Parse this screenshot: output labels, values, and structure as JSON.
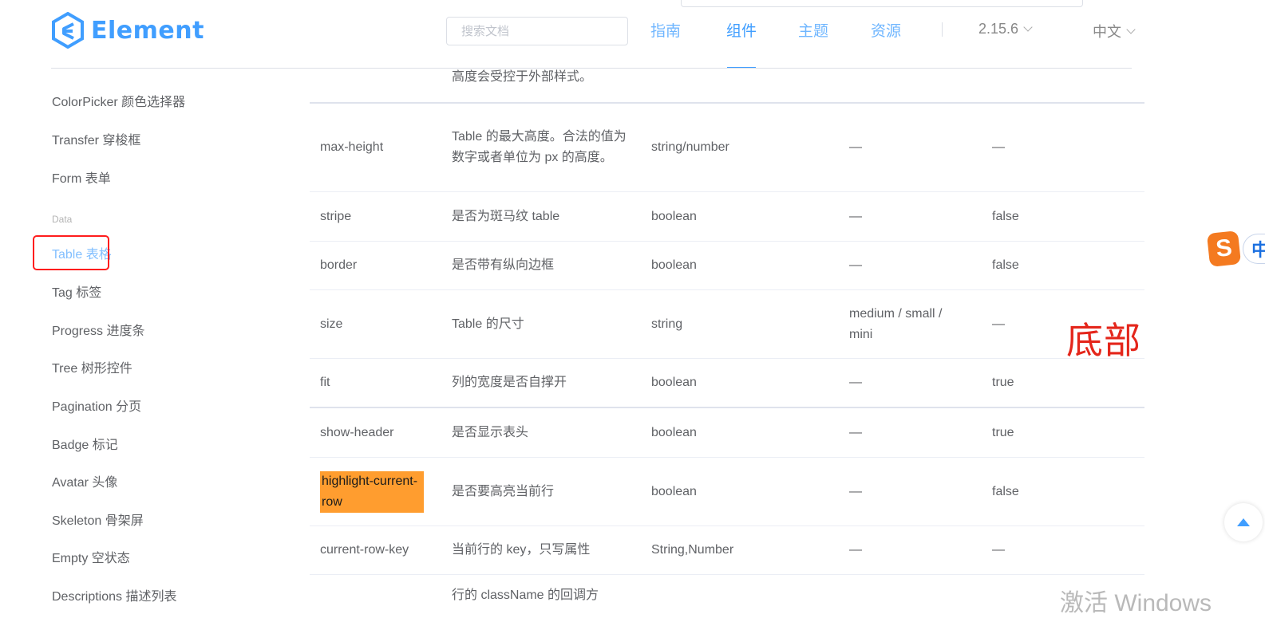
{
  "header": {
    "logo_text": "Element",
    "search_placeholder": "搜索文档",
    "nav": [
      "指南",
      "组件",
      "主题",
      "资源"
    ],
    "active_nav": "组件",
    "version": "2.15.6",
    "language": "中文",
    "accent_color": "#409eff"
  },
  "sidebar": {
    "items_top": [
      "ColorPicker 颜色选择器",
      "Transfer 穿梭框",
      "Form 表单"
    ],
    "group_label": "Data",
    "items_bottom": [
      "Table 表格",
      "Tag 标签",
      "Progress 进度条",
      "Tree 树形控件",
      "Pagination 分页",
      "Badge 标记",
      "Avatar 头像",
      "Skeleton 骨架屏",
      "Empty 空状态",
      "Descriptions 描述列表"
    ],
    "active_item": "Table 表格"
  },
  "table": {
    "partial_top_text": "高度会受控于外部样式。",
    "rows": [
      {
        "param": "max-height",
        "desc": "Table 的最大高度。合法的值为数字或者单位为 px 的高度。",
        "type": "string/number",
        "options": "—",
        "default": "—"
      },
      {
        "param": "stripe",
        "desc": "是否为斑马纹 table",
        "type": "boolean",
        "options": "—",
        "default": "false"
      },
      {
        "param": "border",
        "desc": "是否带有纵向边框",
        "type": "boolean",
        "options": "—",
        "default": "false"
      },
      {
        "param": "size",
        "desc": "Table 的尺寸",
        "type": "string",
        "options": "medium / small / mini",
        "default": "—"
      },
      {
        "param": "fit",
        "desc": "列的宽度是否自撑开",
        "type": "boolean",
        "options": "—",
        "default": "true"
      },
      {
        "param": "show-header",
        "desc": "是否显示表头",
        "type": "boolean",
        "options": "—",
        "default": "true"
      },
      {
        "param": "highlight-current-row",
        "desc": "是否要高亮当前行",
        "type": "boolean",
        "options": "—",
        "default": "false"
      },
      {
        "param": "current-row-key",
        "desc": "当前行的 key，只写属性",
        "type": "String,Number",
        "options": "—",
        "default": "—"
      }
    ],
    "partial_bottom_text": "行的 className 的回调方"
  },
  "overlay": {
    "annotation_text": "底部",
    "ime_letter": "S",
    "ime_mode": "中",
    "watermark": "激活 Windows"
  }
}
